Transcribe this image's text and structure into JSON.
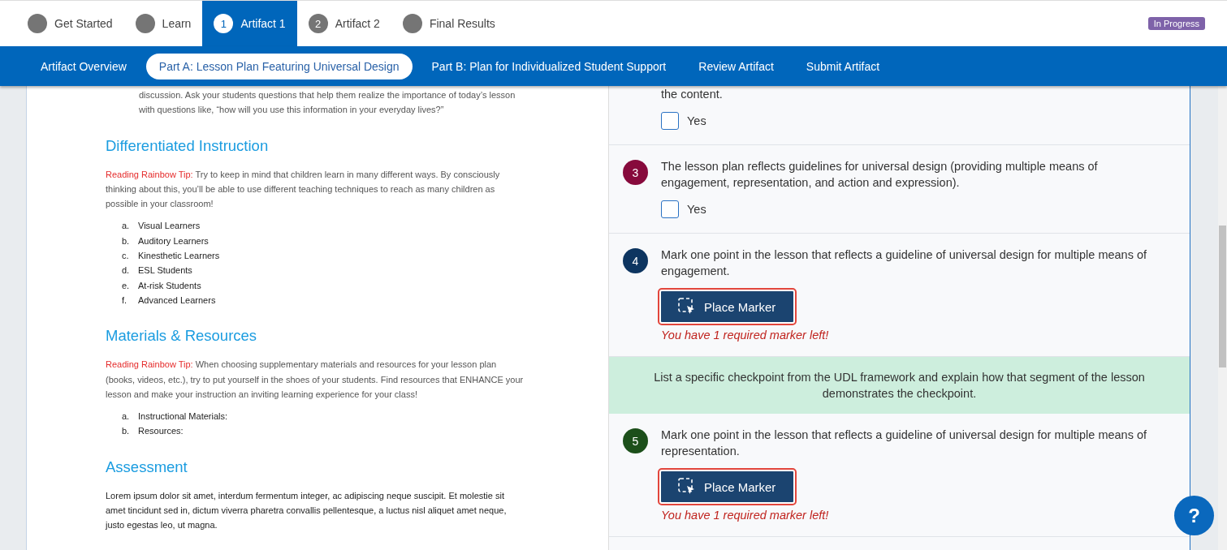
{
  "steps": [
    {
      "label": "Get Started",
      "selected": false
    },
    {
      "label": "Learn",
      "selected": false
    },
    {
      "label": "Artifact 1",
      "number": "1",
      "selected": true
    },
    {
      "label": "Artifact 2",
      "number": "2",
      "selected": false
    },
    {
      "label": "Final Results",
      "selected": false
    }
  ],
  "status_badge": "In Progress",
  "subnav": [
    {
      "label": "Artifact Overview",
      "selected": false
    },
    {
      "label": "Part A: Lesson Plan Featuring Universal Design",
      "selected": true
    },
    {
      "label": "Part B: Plan for Individualized Student Support",
      "selected": false
    },
    {
      "label": "Review Artifact",
      "selected": false
    },
    {
      "label": "Submit Artifact",
      "selected": false
    }
  ],
  "document": [
    {
      "kind": "indented",
      "text": "discussion. Ask your students questions that help them realize the importance of today’s lesson with questions like, “how will you use this information in your everyday lives?”"
    },
    {
      "kind": "heading",
      "text": "Differentiated Instruction"
    },
    {
      "kind": "tip",
      "label": "Reading Rainbow Tip:",
      "text": "Try to keep in mind that children learn in many different ways. By consciously thinking about this, you’ll be able to use different teaching techniques to reach as many children as possible in your classroom!"
    },
    {
      "kind": "list",
      "items": [
        {
          "marker": "a.",
          "text": "Visual Learners"
        },
        {
          "marker": "b.",
          "text": "Auditory Learners"
        },
        {
          "marker": "c.",
          "text": "Kinesthetic Learners"
        },
        {
          "marker": "d.",
          "text": "ESL Students"
        },
        {
          "marker": "e.",
          "text": "At-risk Students"
        },
        {
          "marker": "f.",
          "text": "Advanced Learners"
        }
      ]
    },
    {
      "kind": "heading",
      "text": "Materials & Resources"
    },
    {
      "kind": "tip",
      "label": "Reading Rainbow Tip:",
      "text": "When choosing supplementary materials and resources for your lesson plan (books, videos, etc.), try to put yourself in the shoes of your students. Find resources that ENHANCE your lesson and make your instruction an inviting learning experience for your class!"
    },
    {
      "kind": "list",
      "items": [
        {
          "marker": "a.",
          "text": "Instructional Materials:"
        },
        {
          "marker": "b.",
          "text": "Resources:"
        }
      ]
    },
    {
      "kind": "heading",
      "text": "Assessment"
    },
    {
      "kind": "body",
      "text": "Lorem ipsum dolor sit amet, interdum fermentum integer, ac adipiscing neque suscipit. Et molestie sit amet tincidunt sed in, dictum viverra pharetra convallis pellentesque, a luctus nisl aliquet amet neque, justo egestas leo, ut magna."
    }
  ],
  "criteria": [
    {
      "kind": "checkbox",
      "text": "the content.",
      "option": {
        "label": "Yes",
        "checked": false
      }
    },
    {
      "kind": "checkbox",
      "number": "3",
      "color": "#870a3c",
      "text": "The lesson plan reflects guidelines for universal design (providing multiple means of engagement, representation, and action and expression).",
      "option": {
        "label": "Yes",
        "checked": false
      }
    },
    {
      "kind": "marker",
      "number": "4",
      "color": "#0d3560",
      "text": "Mark one point in the lesson that reflects a guideline of universal design for multiple means of engagement.",
      "button": "Place Marker",
      "warning": "You have 1 required marker left!"
    },
    {
      "kind": "note",
      "text": "List a specific checkpoint from the UDL framework and explain how that segment of the lesson demonstrates the checkpoint."
    },
    {
      "kind": "marker",
      "number": "5",
      "color": "#1c4f1a",
      "text": "Mark one point in the lesson that reflects a guideline of universal design for multiple means of representation.",
      "button": "Place Marker",
      "warning": "You have 1 required marker left!"
    }
  ],
  "help_button": "?"
}
